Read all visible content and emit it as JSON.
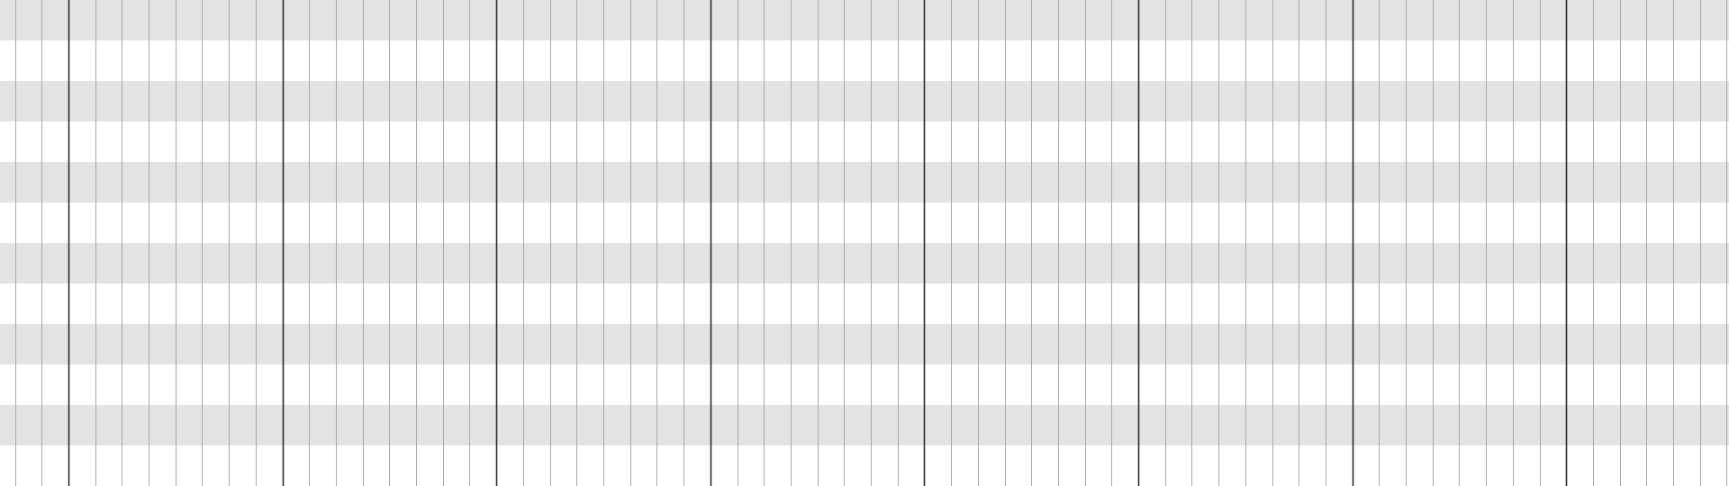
{
  "grid": {
    "colors": {
      "background": "#ffffff",
      "shaded_row": "#e3e3e3",
      "minor_line": "#a8a8a8",
      "major_line": "#2b2b2b"
    },
    "row_count": 12,
    "shaded_rows": "even",
    "minor_divisions_per_major": 8
  }
}
